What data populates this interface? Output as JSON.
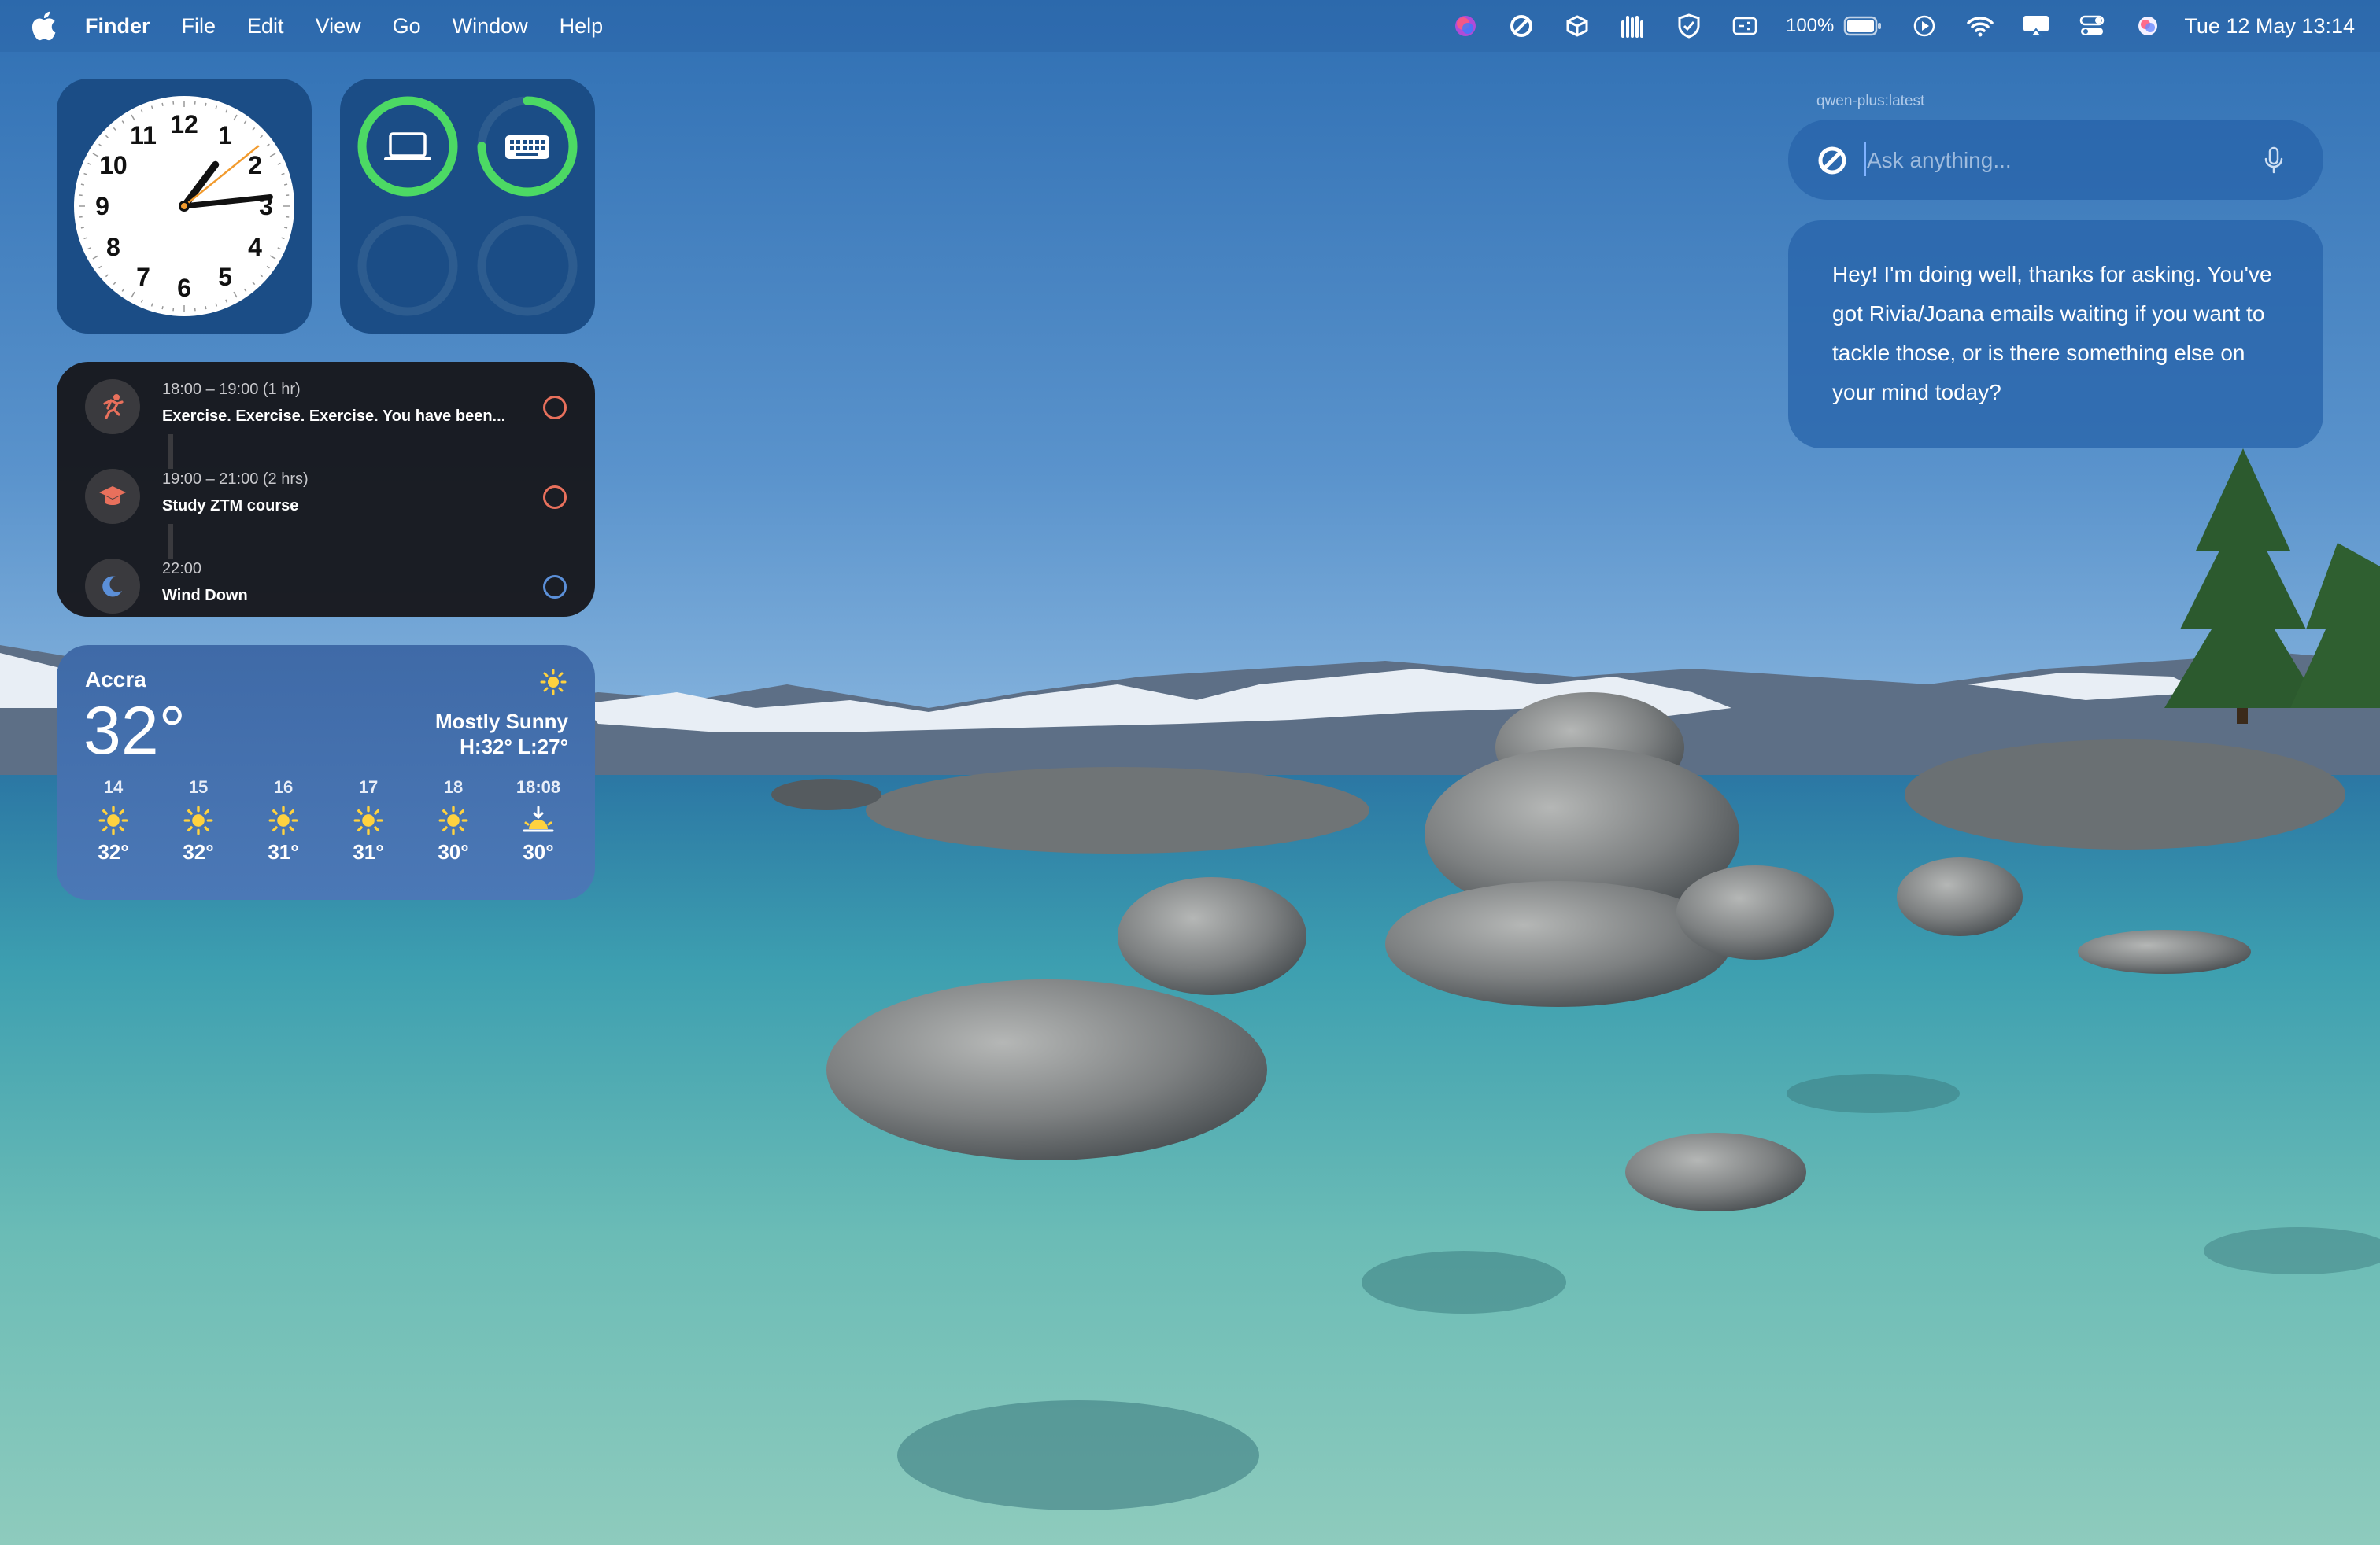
{
  "menubar": {
    "app_name": "Finder",
    "menus": [
      "File",
      "Edit",
      "View",
      "Go",
      "Window",
      "Help"
    ],
    "status_icons": [
      "siri-icon",
      "perplexity-icon",
      "box-icon",
      "hands-icon",
      "shield-icon",
      "input-icon",
      "battery-icon",
      "play-icon",
      "wifi-icon",
      "airplay-icon",
      "control-center-icon",
      "siri-orb-icon"
    ],
    "battery_percent": "100%",
    "battery_level": 1.0,
    "datetime": "Tue 12 May  13:14"
  },
  "clock_widget": {
    "numbers": [
      "12",
      "1",
      "2",
      "3",
      "4",
      "5",
      "6",
      "7",
      "8",
      "9",
      "10",
      "11"
    ],
    "time": "13:14"
  },
  "battery_widget": {
    "devices": [
      {
        "icon": "laptop-icon",
        "level": 1.0
      },
      {
        "icon": "keyboard-icon",
        "level": 0.75
      }
    ],
    "ring_color": "#4cd964"
  },
  "calendar_widget": {
    "events": [
      {
        "time": "18:00 – 19:00 (1 hr)",
        "title": "Exercise. Exercise. Exercise. You have been...",
        "icon": "running-icon",
        "check_color": "#e8705c"
      },
      {
        "time": "19:00 – 21:00 (2 hrs)",
        "title": "Study ZTM course",
        "icon": "graduation-cap-icon",
        "check_color": "#e8705c"
      },
      {
        "time": "22:00",
        "title": "Wind Down",
        "icon": "moon-icon",
        "check_color": "#5b8fd8"
      }
    ]
  },
  "weather_widget": {
    "city": "Accra",
    "temperature": "32°",
    "condition": "Mostly Sunny",
    "high_low": "H:32° L:27°",
    "forecast": [
      {
        "hour": "14",
        "icon": "sun-icon",
        "temp": "32°"
      },
      {
        "hour": "15",
        "icon": "sun-icon",
        "temp": "32°"
      },
      {
        "hour": "16",
        "icon": "sun-icon",
        "temp": "31°"
      },
      {
        "hour": "17",
        "icon": "sun-icon",
        "temp": "31°"
      },
      {
        "hour": "18",
        "icon": "sun-icon",
        "temp": "30°"
      },
      {
        "hour": "18:08",
        "icon": "sunset-icon",
        "temp": "30°"
      }
    ]
  },
  "assistant": {
    "model": "qwen-plus:latest",
    "placeholder": "Ask anything...",
    "response": "Hey! I'm doing well, thanks for asking. You've got Rivia/Joana emails waiting if you want to tackle those, or is there something else on your mind today?"
  }
}
